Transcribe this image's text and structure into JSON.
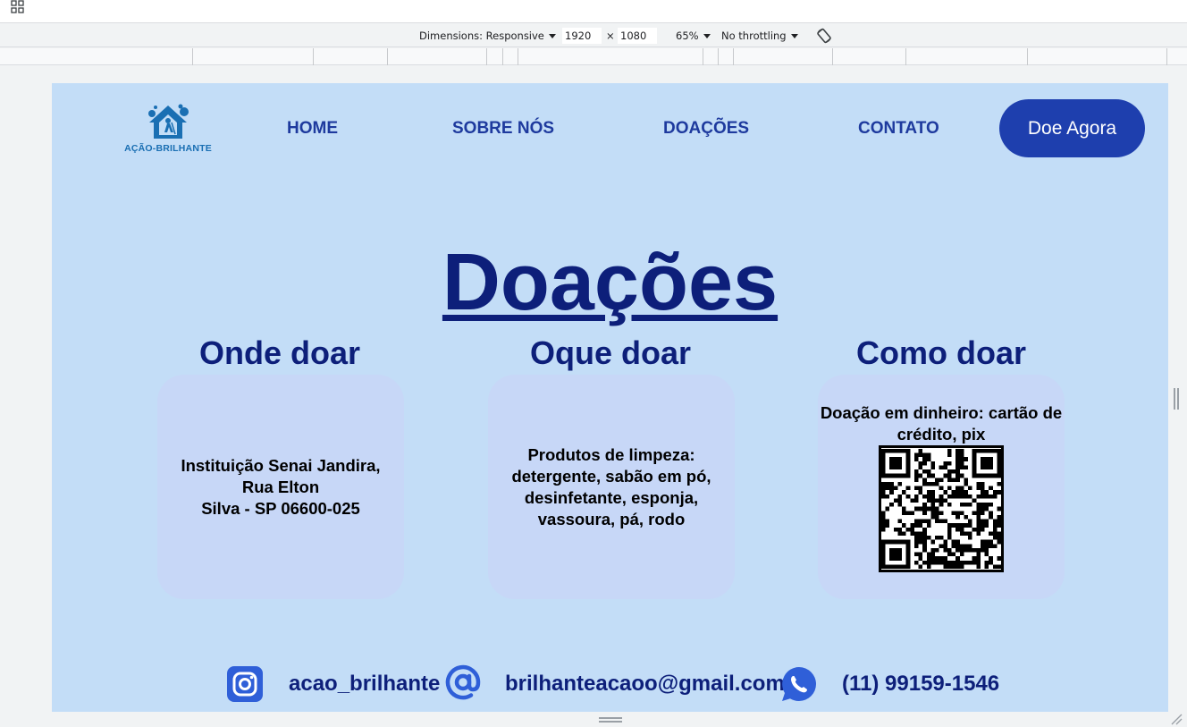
{
  "devtools": {
    "dimensions_label": "Dimensions: Responsive",
    "width_value": "1920",
    "times_sign": "×",
    "height_value": "1080",
    "zoom": "65%",
    "throttling": "No throttling"
  },
  "site": {
    "logo_text": "AÇÃO-BRILHANTE",
    "nav": {
      "home": "HOME",
      "about": "SOBRE NÓS",
      "donations": "DOAÇÕES",
      "contact": "CONTATO"
    },
    "cta_label": "Doe Agora",
    "page_title": "Doações",
    "columns": [
      {
        "heading": "Onde doar",
        "lines": [
          "Instituição Senai Jandira,",
          "Rua Elton",
          "Silva - SP 06600-025"
        ]
      },
      {
        "heading": "Oque doar",
        "lines": [
          "Produtos de limpeza:",
          "detergente, sabão em pó,",
          "desinfetante, esponja,",
          "vassoura, pá, rodo"
        ]
      },
      {
        "heading": "Como doar",
        "lines": [
          "Doação em dinheiro: cartão de",
          "crédito, pix"
        ]
      }
    ],
    "footer": {
      "instagram": "acao_brilhante",
      "email": "brilhanteacaoo@gmail.com",
      "phone": "(11) 99159-1546"
    },
    "colors": {
      "page_bg": "#c3ddf7",
      "card_bg": "#c7d7f7",
      "heading": "#0d1f7a",
      "nav": "#1e3a9e",
      "cta": "#1e3fae",
      "icon_blue": "#2f5fd8"
    },
    "icons": [
      "instagram-icon",
      "at-sign-icon",
      "whatsapp-icon",
      "qr-code"
    ]
  }
}
